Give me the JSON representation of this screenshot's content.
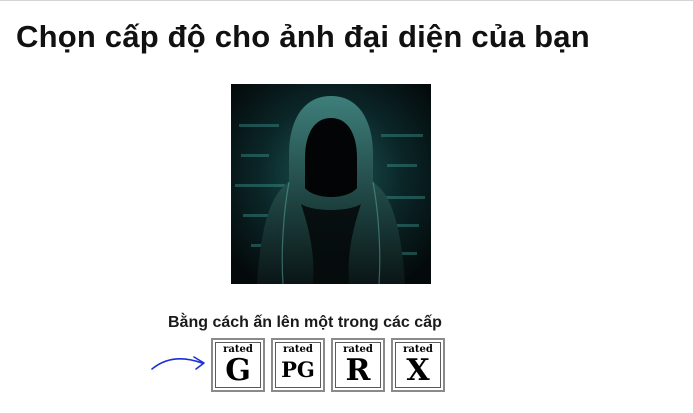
{
  "title": "Chọn cấp độ cho ảnh đại diện của bạn",
  "avatar": {
    "icon": "hooded-figure-avatar"
  },
  "instruction": "Bằng cách ấn lên một trong các cấp",
  "ratings": [
    {
      "rated": "rated",
      "letter": "G"
    },
    {
      "rated": "rated",
      "letter": "PG"
    },
    {
      "rated": "rated",
      "letter": "R"
    },
    {
      "rated": "rated",
      "letter": "X"
    }
  ],
  "colors": {
    "accent_arrow": "#1a2fd6",
    "avatar_glow": "#2f8f8a"
  }
}
